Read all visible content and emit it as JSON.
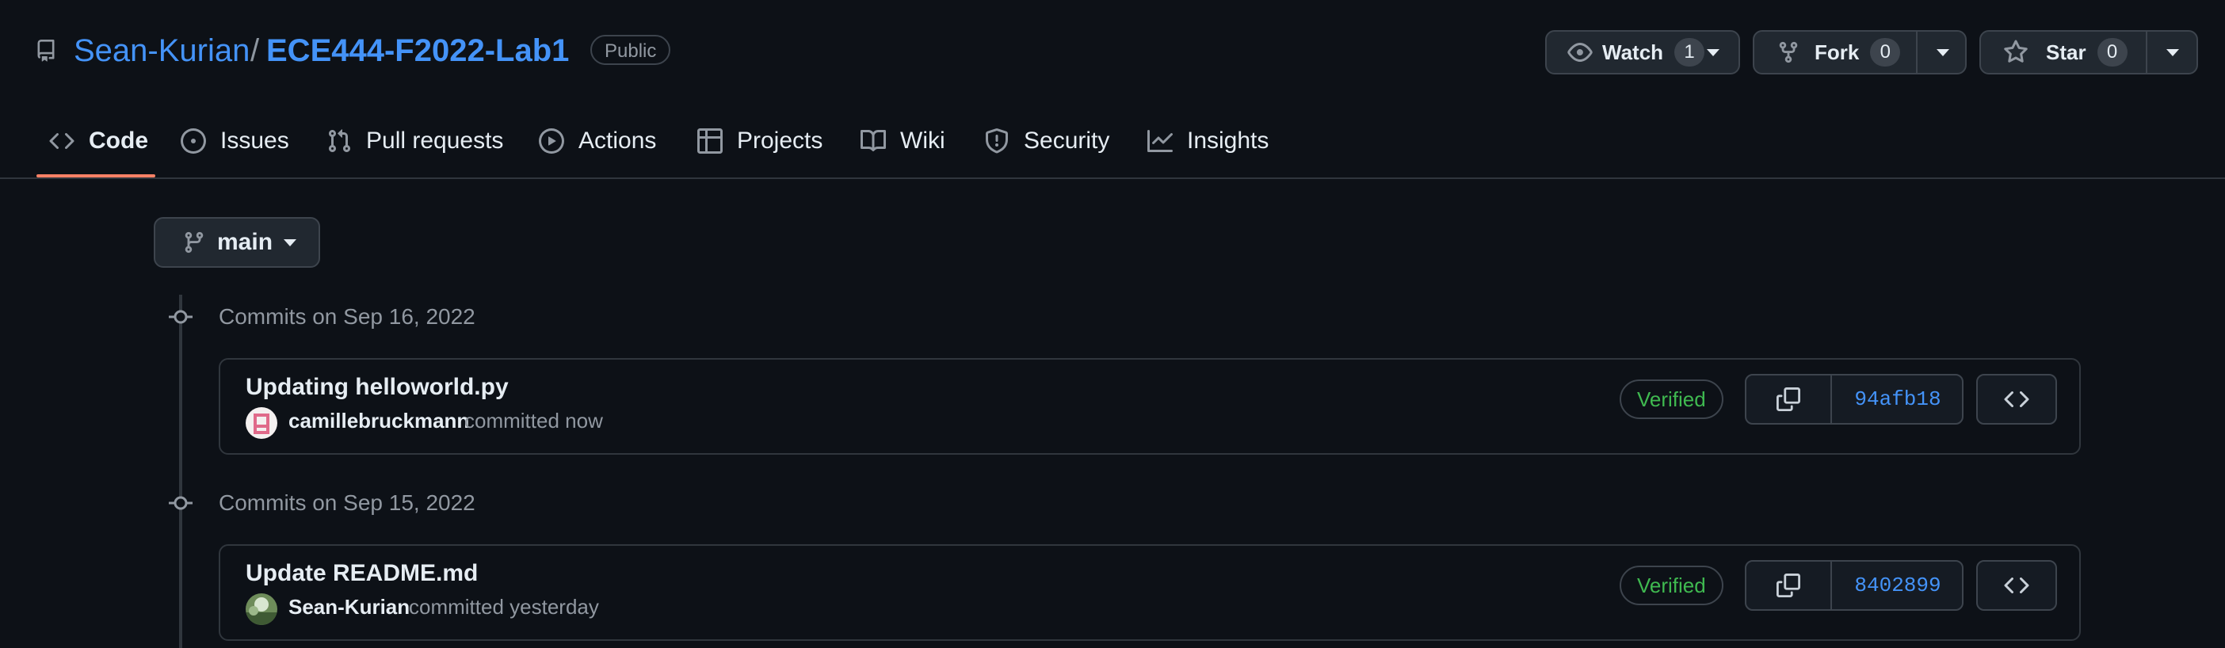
{
  "repo": {
    "owner": "Sean-Kurian",
    "separator": "/",
    "name": "ECE444-F2022-Lab1",
    "visibility": "Public"
  },
  "actions": {
    "watch": {
      "label": "Watch",
      "count": "1"
    },
    "fork": {
      "label": "Fork",
      "count": "0"
    },
    "star": {
      "label": "Star",
      "count": "0"
    }
  },
  "tabs": [
    {
      "label": "Code",
      "icon": "code-icon"
    },
    {
      "label": "Issues",
      "icon": "issue-icon"
    },
    {
      "label": "Pull requests",
      "icon": "pull-request-icon"
    },
    {
      "label": "Actions",
      "icon": "play-icon"
    },
    {
      "label": "Projects",
      "icon": "table-icon"
    },
    {
      "label": "Wiki",
      "icon": "book-icon"
    },
    {
      "label": "Security",
      "icon": "shield-icon"
    },
    {
      "label": "Insights",
      "icon": "graph-icon"
    }
  ],
  "branch": {
    "label": "main"
  },
  "commit_groups": [
    {
      "date_label": "Commits on Sep 16, 2022",
      "commits": [
        {
          "title": "Updating helloworld.py",
          "author": "camillebruckmann",
          "time": "committed now",
          "badge": "Verified",
          "sha": "94afb18"
        }
      ]
    },
    {
      "date_label": "Commits on Sep 15, 2022",
      "commits": [
        {
          "title": "Update README.md",
          "author": "Sean-Kurian",
          "time": "committed yesterday",
          "badge": "Verified",
          "sha": "8402899"
        }
      ]
    }
  ],
  "colors": {
    "link": "#4493f8",
    "verified": "#3fb950",
    "active_tab": "#f78166",
    "background": "#0d1117"
  }
}
